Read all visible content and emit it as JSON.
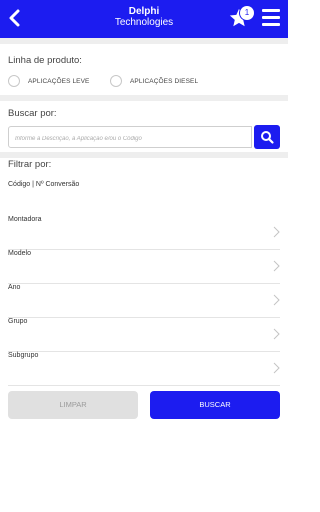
{
  "header": {
    "logo_line1": "Delphi",
    "logo_line2": "Technologies",
    "badge_count": "1"
  },
  "product_line": {
    "label": "Linha de produto:",
    "options": [
      {
        "label": "APLICAÇÕES LEVE"
      },
      {
        "label": "APLICAÇÕES DIESEL"
      }
    ]
  },
  "search": {
    "label": "Buscar por:",
    "placeholder": "Informe a Descrição, a Aplicação e/ou o Código"
  },
  "filter": {
    "label": "Filtrar por:",
    "code_label": "Código | Nº Conversão",
    "items": [
      {
        "label": "Montadora"
      },
      {
        "label": "Modelo"
      },
      {
        "label": "Ano"
      },
      {
        "label": "Grupo"
      },
      {
        "label": "Subgrupo"
      }
    ]
  },
  "actions": {
    "clear_label": "LIMPAR",
    "search_label": "BUSCAR"
  },
  "colors": {
    "brand_blue": "#1c1cf0",
    "disabled_gray": "#e0e0e0"
  }
}
